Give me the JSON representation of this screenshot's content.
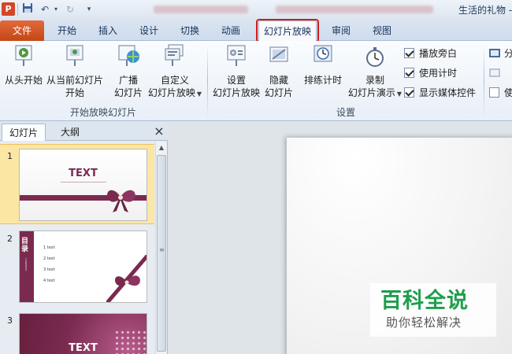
{
  "titlebar": {
    "app_icon": "P",
    "doc_title": "生活的礼物 -"
  },
  "ribbon_tabs": {
    "file": "文件",
    "tabs": [
      {
        "label": "开始"
      },
      {
        "label": "插入"
      },
      {
        "label": "设计"
      },
      {
        "label": "切换"
      },
      {
        "label": "动画"
      },
      {
        "label": "幻灯片放映"
      },
      {
        "label": "审阅"
      },
      {
        "label": "视图"
      }
    ],
    "active": "幻灯片放映"
  },
  "ribbon": {
    "group_start": {
      "label": "开始放映幻灯片",
      "from_beginning": "从头开始",
      "from_current_1": "从当前幻灯片",
      "from_current_2": "开始",
      "broadcast_1": "广播",
      "broadcast_2": "幻灯片",
      "custom_1": "自定义",
      "custom_2": "幻灯片放映"
    },
    "group_setup": {
      "label": "设置",
      "setup_1": "设置",
      "setup_2": "幻灯片放映",
      "hide_1": "隐藏",
      "hide_2": "幻灯片",
      "rehearse": "排练计时",
      "record_1": "录制",
      "record_2": "幻灯片演示",
      "checkboxes": [
        {
          "label": "播放旁白",
          "checked": true
        },
        {
          "label": "使用计时",
          "checked": true
        },
        {
          "label": "显示媒体控件",
          "checked": true
        }
      ]
    },
    "group_monitors": {
      "item1": "分",
      "item3": "使"
    }
  },
  "left_pane": {
    "tabs": [
      {
        "label": "幻灯片"
      },
      {
        "label": "大纲"
      }
    ],
    "close": "×",
    "slides": [
      {
        "number": "1",
        "title": "TEXT"
      },
      {
        "number": "2",
        "heading": "目录",
        "heading_en": "CONTENTS",
        "items": [
          "1 text",
          "2 text",
          "3 text",
          "4 text"
        ]
      },
      {
        "number": "3",
        "title": "TEXT"
      }
    ]
  },
  "watermark": {
    "title": "百科全说",
    "subtitle": "助你轻松解决"
  },
  "colors": {
    "accent_plum": "#7a2a4f",
    "file_tab": "#d24726",
    "highlight": "#d41a1a",
    "watermark_green": "#1f9e4d"
  }
}
